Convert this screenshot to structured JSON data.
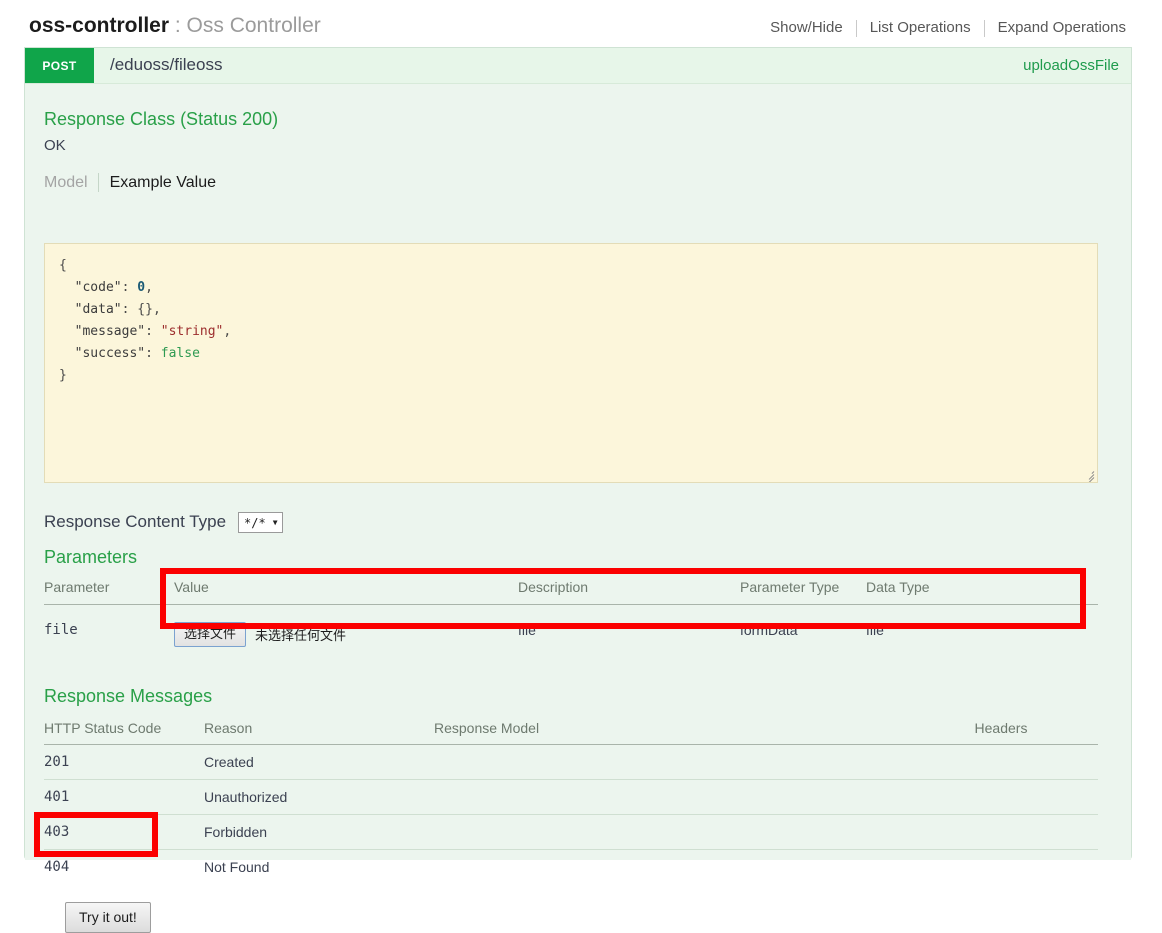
{
  "resource": {
    "id": "oss-controller",
    "separator": " : ",
    "description": "Oss Controller",
    "options": [
      {
        "label": "Show/Hide",
        "name": "show-hide"
      },
      {
        "label": "List Operations",
        "name": "list-operations"
      },
      {
        "label": "Expand Operations",
        "name": "expand-operations"
      }
    ]
  },
  "operation": {
    "method": "POST",
    "path": "/eduoss/fileoss",
    "summary": "uploadOssFile",
    "method_color": "#10a54a",
    "summary_color": "#1f9b4d"
  },
  "response_class": {
    "title": "Response Class (Status 200)",
    "status_text": "OK",
    "tabs": {
      "model": "Model",
      "example_value": "Example Value"
    },
    "example": {
      "open_brace": "{",
      "close_brace": "}",
      "lines": [
        {
          "key": "\"code\"",
          "sep": ": ",
          "value": "0",
          "type": "num",
          "comma": ","
        },
        {
          "key": "\"data\"",
          "sep": ": ",
          "value": "{}",
          "type": "punc",
          "comma": ","
        },
        {
          "key": "\"message\"",
          "sep": ": ",
          "value": "\"string\"",
          "type": "str",
          "comma": ","
        },
        {
          "key": "\"success\"",
          "sep": ": ",
          "value": "false",
          "type": "bool",
          "comma": ""
        }
      ]
    }
  },
  "response_content_type": {
    "label": "Response Content Type",
    "selected": "*/*",
    "caret": "▼"
  },
  "parameters": {
    "title": "Parameters",
    "headers": {
      "parameter": "Parameter",
      "value": "Value",
      "description": "Description",
      "parameter_type": "Parameter Type",
      "data_type": "Data Type"
    },
    "rows": [
      {
        "parameter": "file",
        "file_button": "选择文件",
        "file_status": "未选择任何文件",
        "description": "file",
        "parameter_type": "formData",
        "data_type": "file"
      }
    ]
  },
  "response_messages": {
    "title": "Response Messages",
    "headers": {
      "code": "HTTP Status Code",
      "reason": "Reason",
      "model": "Response Model",
      "headers": "Headers"
    },
    "rows": [
      {
        "code": "201",
        "reason": "Created",
        "model": "",
        "headers": ""
      },
      {
        "code": "401",
        "reason": "Unauthorized",
        "model": "",
        "headers": ""
      },
      {
        "code": "403",
        "reason": "Forbidden",
        "model": "",
        "headers": ""
      },
      {
        "code": "404",
        "reason": "Not Found",
        "model": "",
        "headers": ""
      }
    ]
  },
  "try_it_out": {
    "label": "Try it out!"
  },
  "annotations": {
    "color": "#fb0000",
    "boxes": [
      {
        "name": "parameters-row-highlight"
      },
      {
        "name": "try-it-out-highlight"
      }
    ]
  }
}
